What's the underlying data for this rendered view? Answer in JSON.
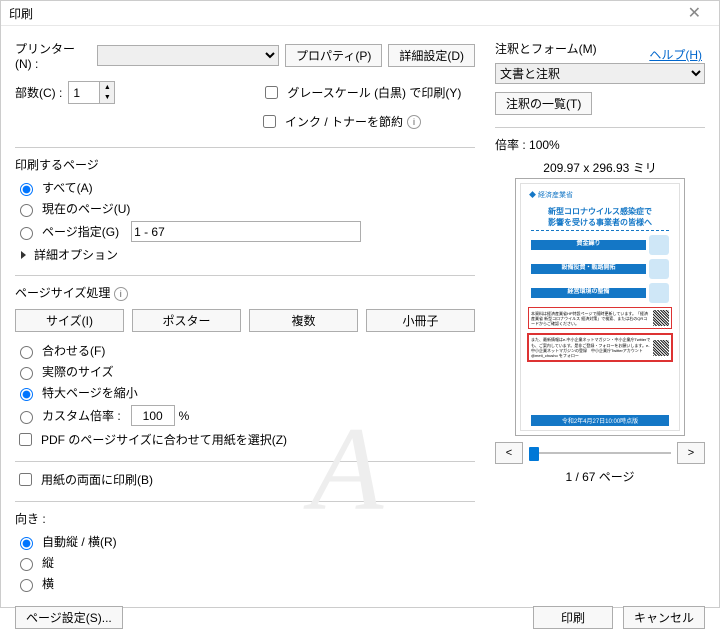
{
  "title": "印刷",
  "help_link": "ヘルプ(H)",
  "printer_label": "プリンター(N) :",
  "printer_value": "",
  "properties_btn": "プロパティ(P)",
  "advanced_btn": "詳細設定(D)",
  "copies_label": "部数(C) :",
  "copies_value": "1",
  "grayscale_label": "グレースケール (白黒) で印刷(Y)",
  "savetoner_label": "インク / トナーを節約",
  "range": {
    "title": "印刷するページ",
    "all": "すべて(A)",
    "current": "現在のページ(U)",
    "pages": "ページ指定(G)",
    "pages_value": "1 - 67",
    "more": "詳細オプション"
  },
  "sizing": {
    "title": "ページサイズ処理",
    "tabs": {
      "size": "サイズ(I)",
      "poster": "ポスター",
      "multi": "複数",
      "book": "小冊子"
    },
    "fit": "合わせる(F)",
    "actual": "実際のサイズ",
    "shrink": "特大ページを縮小",
    "custom": "カスタム倍率 :",
    "custom_value": "100",
    "custom_unit": "%",
    "paper_source": "PDF のページサイズに合わせて用紙を選択(Z)"
  },
  "duplex": "用紙の両面に印刷(B)",
  "orient": {
    "title": "向き :",
    "auto": "自動縦 / 横(R)",
    "portrait": "縦",
    "landscape": "横"
  },
  "comments": {
    "title": "注釈とフォーム(M)",
    "value": "文書と注釈",
    "summary_btn": "注釈の一覧(T)"
  },
  "zoom_label": "倍率 :",
  "zoom_value": "100%",
  "paper_dim": "209.97 x 296.93 ミリ",
  "preview": {
    "logo": "経済産業省",
    "heading1": "新型コロナウイルス感染症で",
    "heading2": "影響を受ける事業者の皆様へ",
    "bar1": "資金繰り",
    "bar2": "設備投資・販路開拓",
    "bar3": "経営環境の整備",
    "box1_text": "本資料は経済産業省HP特設ページで随時更新しています。「経済産業省 新型コロナウイルス 経済対策」で検索、または右のQRコードからご確認ください。",
    "box2_text": "また、最新情報はe-中小企業ネットマガジン・中小企業庁Twitterでも、ご案内しています。是非ご登録・フォローをお願いします。e-中小企業ネットマガジンの登録　中小企業庁Twitterアカウント @meti_chusho をフォロー",
    "date": "令和2年4月27日10:00時点版"
  },
  "nav_page": "1 / 67 ページ",
  "page_setup_btn": "ページ設定(S)...",
  "print_btn": "印刷",
  "cancel_btn": "キャンセル"
}
